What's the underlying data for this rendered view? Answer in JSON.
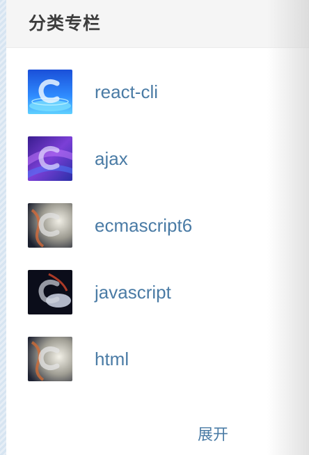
{
  "sidebar": {
    "title": "分类专栏",
    "columns": [
      {
        "label": "react-cli",
        "thumb": "thumb-blue"
      },
      {
        "label": "ajax",
        "thumb": "thumb-purple"
      },
      {
        "label": "ecmascript6",
        "thumb": "thumb-flame"
      },
      {
        "label": "javascript",
        "thumb": "thumb-dark"
      },
      {
        "label": "html",
        "thumb": "thumb-flame"
      }
    ],
    "expand_label": "展开"
  },
  "colors": {
    "link": "#4a7ba5",
    "title": "#3d3d3d",
    "header_bg": "#f5f5f5"
  }
}
